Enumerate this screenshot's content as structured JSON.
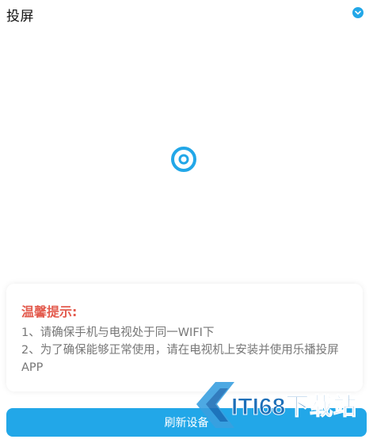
{
  "header": {
    "title": "投屏",
    "toggle_icon": "chevron-down-icon",
    "accent": "#22a7e8"
  },
  "loading": {
    "icon": "loading-ring-icon",
    "color": "#22a7e8"
  },
  "tips": {
    "title": "温馨提示:",
    "title_color": "#e35b4e",
    "lines": [
      "1、请确保手机与电视处于同一WIFI下",
      "2、为了确保能够正常使用，请在电视机上安装并使用乐播投屏APP"
    ]
  },
  "refresh_button": {
    "label": "刷新设备"
  },
  "watermark": {
    "text": "ITI68下载站"
  }
}
